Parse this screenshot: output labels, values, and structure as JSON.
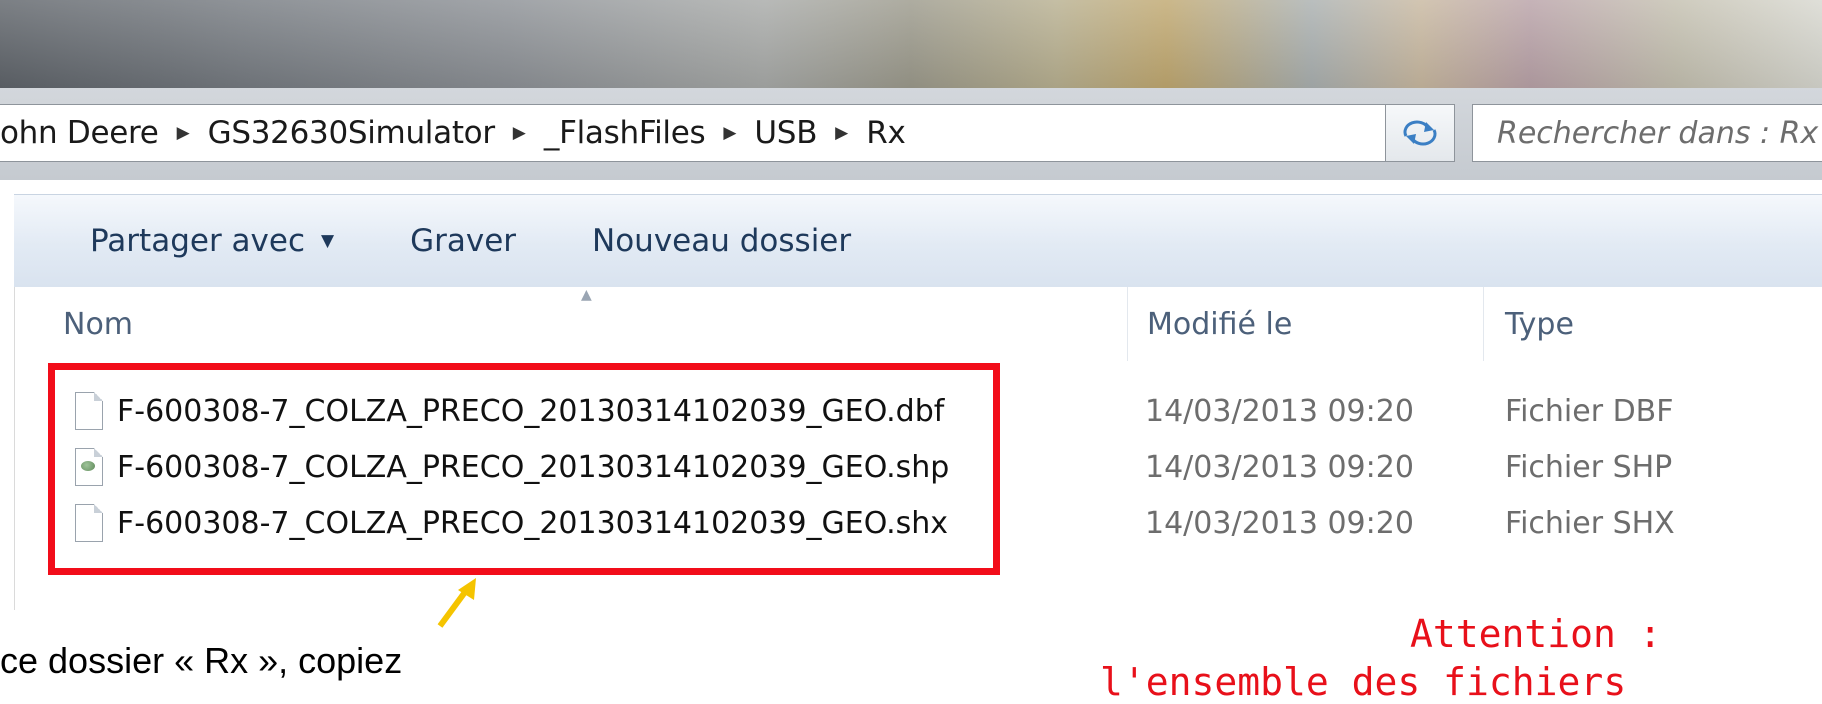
{
  "window": {
    "breadcrumbs": [
      "ohn Deere",
      "GS32630Simulator",
      "_FlashFiles",
      "USB",
      "Rx"
    ],
    "search_placeholder": "Rechercher dans : Rx"
  },
  "toolbar": {
    "share_label": "Partager avec",
    "burn_label": "Graver",
    "new_folder_label": "Nouveau dossier"
  },
  "columns": {
    "name": "Nom",
    "modified": "Modifié le",
    "type": "Type"
  },
  "files": [
    {
      "name": "F-600308-7_COLZA_PRECO_20130314102039_GEO.dbf",
      "modified": "14/03/2013 09:20",
      "type": "Fichier DBF",
      "icon": "document-icon"
    },
    {
      "name": "F-600308-7_COLZA_PRECO_20130314102039_GEO.shp",
      "modified": "14/03/2013 09:20",
      "type": "Fichier SHP",
      "icon": "shapefile-icon"
    },
    {
      "name": "F-600308-7_COLZA_PRECO_20130314102039_GEO.shx",
      "modified": "14/03/2013 09:20",
      "type": "Fichier SHX",
      "icon": "document-icon"
    }
  ],
  "annotations": {
    "caption": "ce dossier « Rx », copiez",
    "attention_title": "Attention :",
    "attention_line": "l'ensemble des fichiers",
    "highlight_color": "#f20d1a",
    "arrow_color": "#f5c400"
  }
}
